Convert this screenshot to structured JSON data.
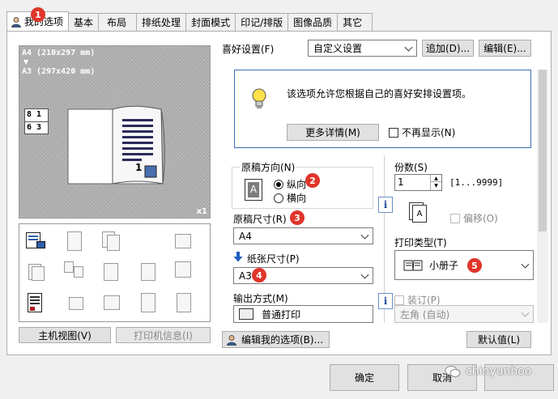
{
  "tabs": [
    {
      "label": "我的选项",
      "active": true
    },
    {
      "label": "基本"
    },
    {
      "label": "布局"
    },
    {
      "label": "排纸处理"
    },
    {
      "label": "封面模式"
    },
    {
      "label": "印记/排版"
    },
    {
      "label": "图像品质"
    },
    {
      "label": "其它"
    }
  ],
  "preview": {
    "line1": "A4 (210x297 mm)",
    "arrow": "▼",
    "line2": "A3 (297x420 mm)",
    "pages_top": "8 1",
    "pages_bottom": "6 3",
    "zoom": "x1",
    "page_num": "1"
  },
  "left_buttons": {
    "host_view": "主机视图(V)",
    "printer_info": "打印机信息(I)"
  },
  "favorite": {
    "label": "喜好设置(F)",
    "value": "自定义设置",
    "add": "追加(D)...",
    "edit": "编辑(E)..."
  },
  "info": {
    "text": "该选项允许您根据自己的喜好安排设置项。",
    "more": "更多详情(M)",
    "no_show": "不再显示(N)"
  },
  "orientation": {
    "label": "原稿方向(N)",
    "portrait": "纵向",
    "landscape": "横向",
    "icon_letter": "A"
  },
  "original_size": {
    "label": "原稿尺寸(R)",
    "value": "A4"
  },
  "paper_size": {
    "label": "纸张尺寸(P)",
    "value": "A3"
  },
  "output": {
    "label": "输出方式(M)",
    "value": "普通打印"
  },
  "copies": {
    "label": "份数(S)",
    "value": "1",
    "range": "[1...9999]"
  },
  "offset": {
    "label": "偏移(O)"
  },
  "print_type": {
    "label": "打印类型(T)",
    "value": "小册子"
  },
  "binding": {
    "label": "装订(P)",
    "value": "左角 (自动)"
  },
  "edit_options": "编辑我的选项(B)...",
  "defaults": "默认值(L)",
  "dialog": {
    "ok": "确定",
    "cancel": "取消"
  },
  "watermark": "chinyunhoo",
  "badges": [
    "1",
    "2",
    "3",
    "4",
    "5"
  ],
  "colors": {
    "accent_red": "#e0352b",
    "focus_blue": "#3c6fb5",
    "arrow_blue": "#1f5fbf"
  }
}
